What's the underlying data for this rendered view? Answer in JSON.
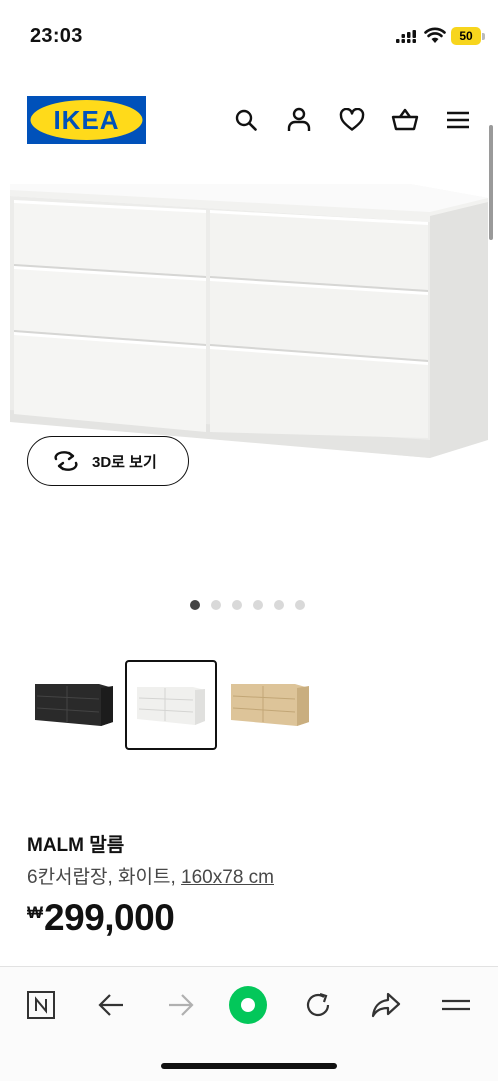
{
  "status_bar": {
    "time": "23:03",
    "battery_level": "50",
    "icons": [
      "cellular-signal-icon",
      "wifi-icon",
      "battery-icon"
    ]
  },
  "header": {
    "logo_text": "IKEA",
    "icons": [
      "search-icon",
      "user-icon",
      "heart-icon",
      "cart-icon",
      "menu-icon"
    ],
    "colors": {
      "logo_blue": "#0051ba",
      "logo_yellow": "#ffda1a"
    }
  },
  "hero": {
    "view_3d_label": "3D로 보기",
    "carousel": {
      "total_slides": 6,
      "active_index": 0
    }
  },
  "variants": [
    {
      "name": "black-brown",
      "color": "#2a2a2a",
      "selected": false
    },
    {
      "name": "white",
      "color": "#f4f4f2",
      "selected": true
    },
    {
      "name": "oak",
      "color": "#ddc499",
      "selected": false
    }
  ],
  "product": {
    "name": "MALM 말름",
    "description": "6칸서랍장, 화이트, ",
    "measurement": "160x78 cm",
    "currency": "₩",
    "price": "299,000"
  },
  "browser_bar": {
    "icons": [
      "naver-icon",
      "back-arrow-icon",
      "forward-arrow-icon",
      "green-home-icon",
      "refresh-icon",
      "share-icon",
      "hamburger-menu-icon"
    ],
    "accent_color": "#03c75a"
  }
}
